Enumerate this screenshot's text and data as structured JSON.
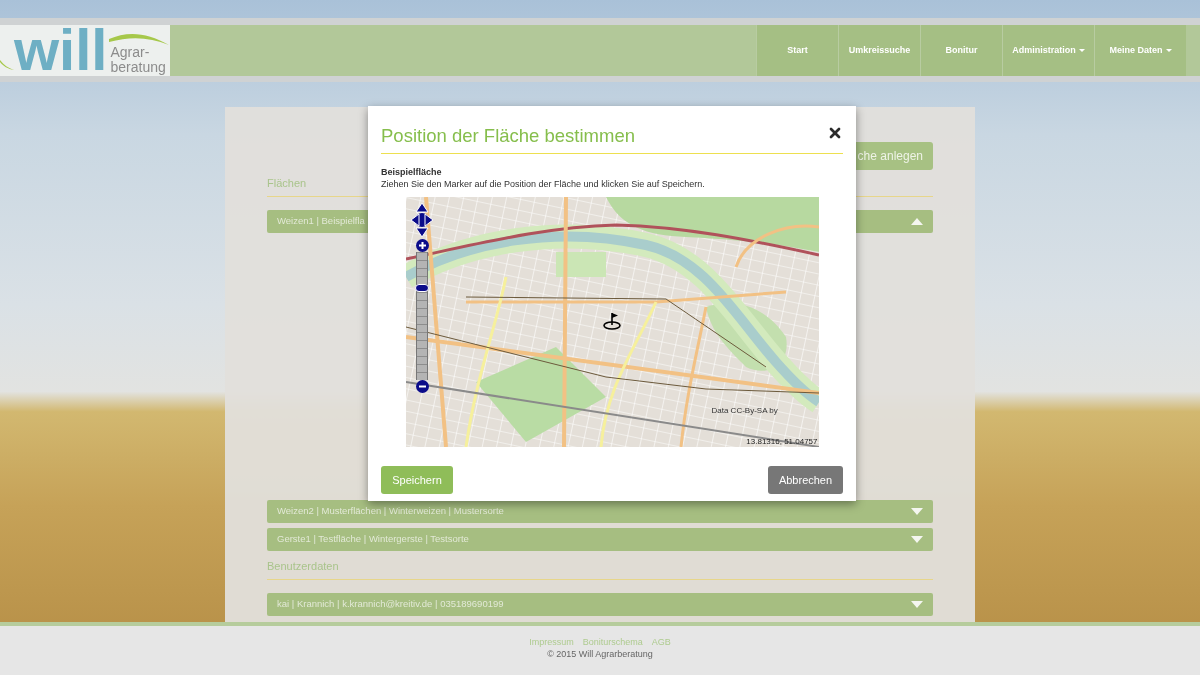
{
  "header": {
    "logo": {
      "wordmark": "will",
      "line_1": "Agrar-",
      "line_2": "beratung"
    },
    "nav": [
      {
        "label": "Start",
        "dropdown": false
      },
      {
        "label": "Umkreissuche",
        "dropdown": false
      },
      {
        "label": "Bonitur",
        "dropdown": false
      },
      {
        "label": "Administration",
        "dropdown": true
      },
      {
        "label": "Meine Daten",
        "dropdown": true
      }
    ]
  },
  "page": {
    "add_button": "che anlegen",
    "sections": [
      {
        "title": "Flächen",
        "rows": [
          {
            "label": "Weizen1 | Beispielfla",
            "expanded": true
          },
          {
            "label": "Weizen2 | Musterflächen | Winterweizen | Mustersorte",
            "expanded": false
          },
          {
            "label": "Gerste1 | Testfläche | Wintergerste | Testsorte",
            "expanded": false
          }
        ]
      },
      {
        "title": "Benutzerdaten",
        "rows": [
          {
            "label": "kai | Krannich | k.krannich@kreitiv.de | 035189690199",
            "expanded": false
          }
        ]
      }
    ]
  },
  "dialog": {
    "title": "Position der Fläche bestimmen",
    "subtitle": "Beispielfläche",
    "instruction": "Ziehen Sie den Marker auf die Position der Fläche und klicken Sie auf Speichern.",
    "map": {
      "zoom": {
        "level": 0.72
      },
      "attribution": "Data CC-By-SA by",
      "coordinates": "13.81316, 51.04757"
    },
    "buttons": [
      {
        "label": "Speichern",
        "kind": "primary"
      },
      {
        "label": "Abbrechen",
        "kind": "secondary"
      }
    ]
  },
  "footer": {
    "links": [
      "Impressum",
      "Boniturschema",
      "AGB"
    ],
    "copyright": "© 2015 Will Agrarberatung"
  }
}
